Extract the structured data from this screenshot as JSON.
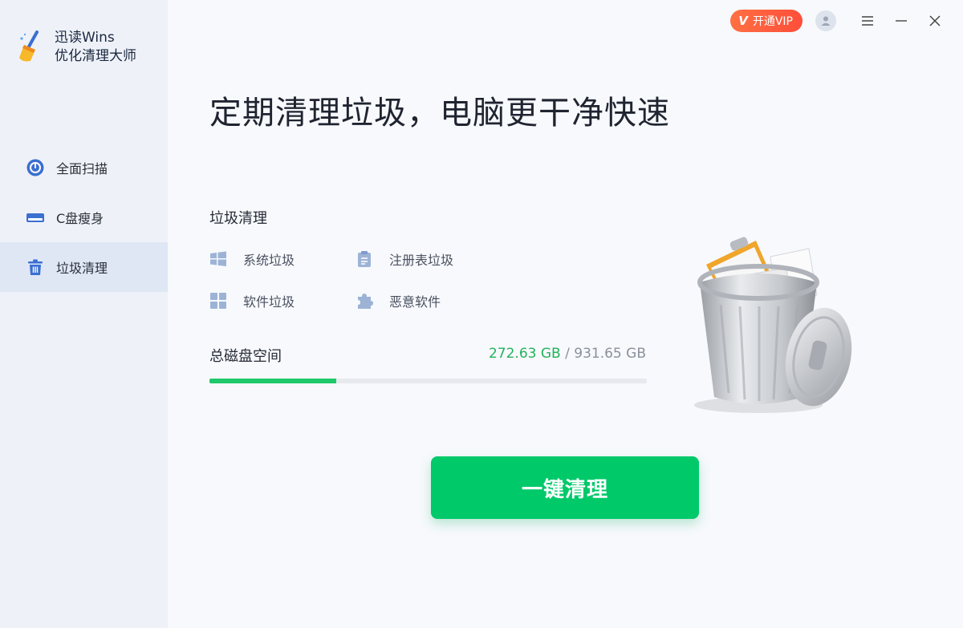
{
  "app": {
    "name_line1": "迅读Wins",
    "name_line2": "优化清理大师"
  },
  "sidebar": {
    "items": [
      {
        "label": "全面扫描",
        "icon": "scan-icon",
        "active": false
      },
      {
        "label": "C盘瘦身",
        "icon": "drive-icon",
        "active": false
      },
      {
        "label": "垃圾清理",
        "icon": "trash-icon",
        "active": true
      }
    ]
  },
  "topbar": {
    "vip_label": "开通VIP",
    "vip_badge": "V"
  },
  "main": {
    "headline": "定期清理垃圾，电脑更干净快速",
    "section_title": "垃圾清理",
    "features": [
      {
        "label": "系统垃圾",
        "icon": "windows-icon"
      },
      {
        "label": "注册表垃圾",
        "icon": "clipboard-icon"
      },
      {
        "label": "软件垃圾",
        "icon": "grid-icon"
      },
      {
        "label": "恶意软件",
        "icon": "puzzle-icon"
      }
    ],
    "disk": {
      "label": "总磁盘空间",
      "used": "272.63 GB",
      "separator": " / ",
      "total": "931.65 GB",
      "used_fraction": 0.29
    },
    "clean_button": "一键清理"
  },
  "colors": {
    "accent_green": "#00c96a",
    "vip_orange": "#ff5a3c",
    "icon_blue": "#3b6fd1"
  }
}
